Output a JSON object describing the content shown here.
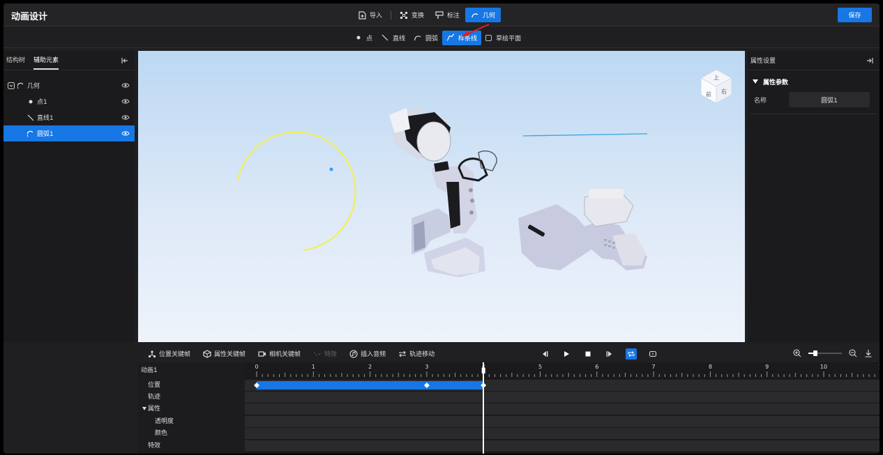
{
  "header": {
    "app_title": "动画设计",
    "tools": [
      {
        "label": "导入",
        "icon": "import-icon",
        "active": false
      },
      {
        "label": "变换",
        "icon": "transform-icon",
        "active": false
      },
      {
        "label": "标注",
        "icon": "annotation-icon",
        "active": false
      },
      {
        "label": "几何",
        "icon": "arc-icon",
        "active": true
      }
    ],
    "save_label": "保存"
  },
  "subbar": {
    "tools": [
      {
        "label": "点",
        "icon": "point-icon",
        "active": false
      },
      {
        "label": "直线",
        "icon": "line-icon",
        "active": false
      },
      {
        "label": "圆弧",
        "icon": "arc-icon",
        "active": false
      },
      {
        "label": "样条线",
        "icon": "spline-icon",
        "active": true
      }
    ],
    "sketch_plane_label": "草绘平面"
  },
  "left_panel": {
    "tabs": [
      {
        "label": "结构树",
        "active": false
      },
      {
        "label": "辅助元素",
        "active": true
      }
    ],
    "tree": [
      {
        "label": "几何",
        "icon": "arc-icon",
        "level": 0,
        "selected": false
      },
      {
        "label": "点1",
        "icon": "point-icon",
        "level": 1,
        "selected": false
      },
      {
        "label": "直线1",
        "icon": "line-icon",
        "level": 1,
        "selected": false
      },
      {
        "label": "圆弧1",
        "icon": "arc-icon",
        "level": 1,
        "selected": true
      }
    ]
  },
  "viewport": {
    "view_cube_labels": [
      "上",
      "前",
      "右"
    ]
  },
  "right_panel": {
    "title": "属性设置",
    "section_title": "属性参数",
    "field_label": "名称",
    "field_value": "圆弧1"
  },
  "timeline": {
    "toolbar": [
      {
        "label": "位置关键帧",
        "icon": "position-keyframe-icon",
        "disabled": false
      },
      {
        "label": "属性关键帧",
        "icon": "property-keyframe-icon",
        "disabled": false
      },
      {
        "label": "相机关键帧",
        "icon": "camera-keyframe-icon",
        "disabled": false
      },
      {
        "label": "特效",
        "icon": "effect-icon",
        "disabled": true
      },
      {
        "label": "插入音频",
        "icon": "audio-icon",
        "disabled": false
      },
      {
        "label": "轨迹移动",
        "icon": "trajectory-icon",
        "disabled": false
      }
    ],
    "animation_name": "动画1",
    "tracks": [
      {
        "label": "位置",
        "sub": false,
        "caret": false
      },
      {
        "label": "轨迹",
        "sub": false,
        "caret": false
      },
      {
        "label": "属性",
        "sub": false,
        "caret": true
      },
      {
        "label": "透明度",
        "sub": true,
        "caret": false
      },
      {
        "label": "颜色",
        "sub": true,
        "caret": false
      },
      {
        "label": "特效",
        "sub": false,
        "caret": false
      }
    ],
    "ruler_labels": [
      "0",
      "1",
      "2",
      "3",
      "4",
      "5",
      "6",
      "7",
      "8",
      "9",
      "10",
      "1"
    ],
    "position_clip": {
      "start": 0,
      "end": 4,
      "keyframes": [
        0,
        3,
        4
      ]
    },
    "playhead_time": 4,
    "zoom_level": 0.2
  }
}
